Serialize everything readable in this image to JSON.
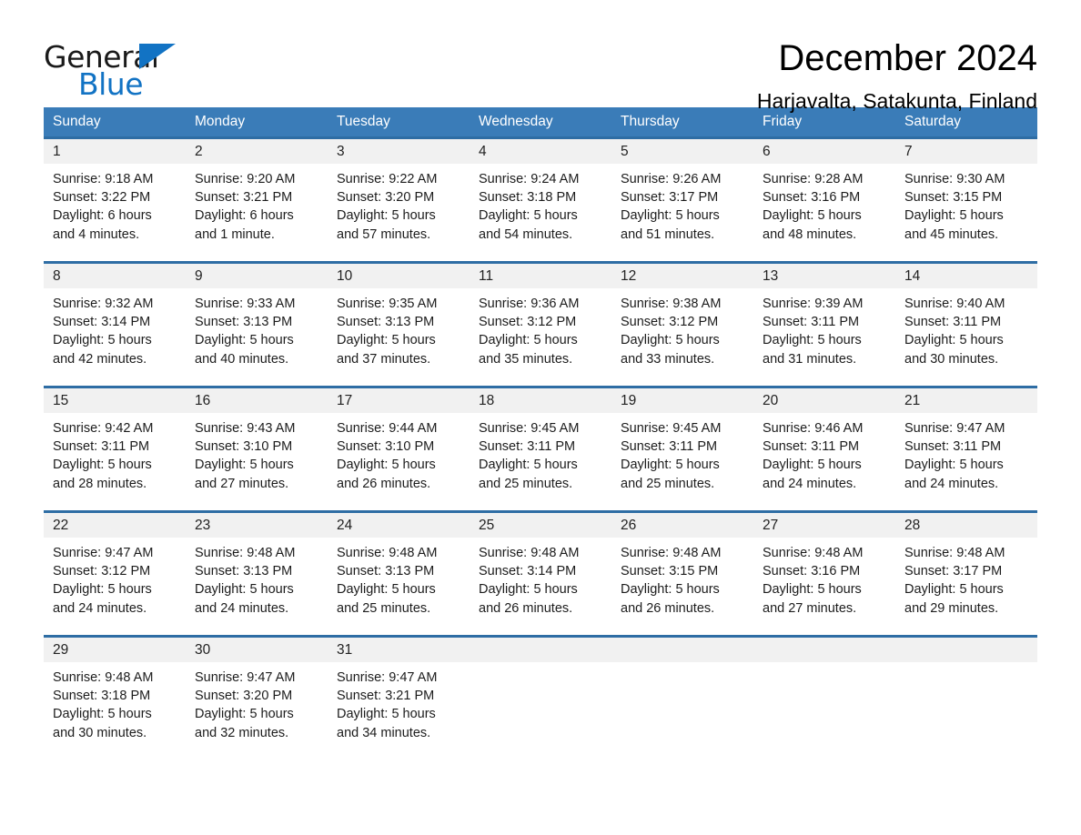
{
  "brand": {
    "name_top": "General",
    "name_bottom": "Blue",
    "accent_color": "#1273c4"
  },
  "header": {
    "title": "December 2024",
    "location": "Harjavalta, Satakunta, Finland"
  },
  "theme": {
    "header_bg": "#3a7cb8",
    "row_rule": "#2e6da4",
    "daynum_bg": "#f1f1f1"
  },
  "calendar": {
    "weekdays": [
      "Sunday",
      "Monday",
      "Tuesday",
      "Wednesday",
      "Thursday",
      "Friday",
      "Saturday"
    ],
    "weeks": [
      {
        "days": [
          {
            "date": "1",
            "sunrise": "Sunrise: 9:18 AM",
            "sunset": "Sunset: 3:22 PM",
            "daylight_line1": "Daylight: 6 hours",
            "daylight_line2": "and 4 minutes."
          },
          {
            "date": "2",
            "sunrise": "Sunrise: 9:20 AM",
            "sunset": "Sunset: 3:21 PM",
            "daylight_line1": "Daylight: 6 hours",
            "daylight_line2": "and 1 minute."
          },
          {
            "date": "3",
            "sunrise": "Sunrise: 9:22 AM",
            "sunset": "Sunset: 3:20 PM",
            "daylight_line1": "Daylight: 5 hours",
            "daylight_line2": "and 57 minutes."
          },
          {
            "date": "4",
            "sunrise": "Sunrise: 9:24 AM",
            "sunset": "Sunset: 3:18 PM",
            "daylight_line1": "Daylight: 5 hours",
            "daylight_line2": "and 54 minutes."
          },
          {
            "date": "5",
            "sunrise": "Sunrise: 9:26 AM",
            "sunset": "Sunset: 3:17 PM",
            "daylight_line1": "Daylight: 5 hours",
            "daylight_line2": "and 51 minutes."
          },
          {
            "date": "6",
            "sunrise": "Sunrise: 9:28 AM",
            "sunset": "Sunset: 3:16 PM",
            "daylight_line1": "Daylight: 5 hours",
            "daylight_line2": "and 48 minutes."
          },
          {
            "date": "7",
            "sunrise": "Sunrise: 9:30 AM",
            "sunset": "Sunset: 3:15 PM",
            "daylight_line1": "Daylight: 5 hours",
            "daylight_line2": "and 45 minutes."
          }
        ]
      },
      {
        "days": [
          {
            "date": "8",
            "sunrise": "Sunrise: 9:32 AM",
            "sunset": "Sunset: 3:14 PM",
            "daylight_line1": "Daylight: 5 hours",
            "daylight_line2": "and 42 minutes."
          },
          {
            "date": "9",
            "sunrise": "Sunrise: 9:33 AM",
            "sunset": "Sunset: 3:13 PM",
            "daylight_line1": "Daylight: 5 hours",
            "daylight_line2": "and 40 minutes."
          },
          {
            "date": "10",
            "sunrise": "Sunrise: 9:35 AM",
            "sunset": "Sunset: 3:13 PM",
            "daylight_line1": "Daylight: 5 hours",
            "daylight_line2": "and 37 minutes."
          },
          {
            "date": "11",
            "sunrise": "Sunrise: 9:36 AM",
            "sunset": "Sunset: 3:12 PM",
            "daylight_line1": "Daylight: 5 hours",
            "daylight_line2": "and 35 minutes."
          },
          {
            "date": "12",
            "sunrise": "Sunrise: 9:38 AM",
            "sunset": "Sunset: 3:12 PM",
            "daylight_line1": "Daylight: 5 hours",
            "daylight_line2": "and 33 minutes."
          },
          {
            "date": "13",
            "sunrise": "Sunrise: 9:39 AM",
            "sunset": "Sunset: 3:11 PM",
            "daylight_line1": "Daylight: 5 hours",
            "daylight_line2": "and 31 minutes."
          },
          {
            "date": "14",
            "sunrise": "Sunrise: 9:40 AM",
            "sunset": "Sunset: 3:11 PM",
            "daylight_line1": "Daylight: 5 hours",
            "daylight_line2": "and 30 minutes."
          }
        ]
      },
      {
        "days": [
          {
            "date": "15",
            "sunrise": "Sunrise: 9:42 AM",
            "sunset": "Sunset: 3:11 PM",
            "daylight_line1": "Daylight: 5 hours",
            "daylight_line2": "and 28 minutes."
          },
          {
            "date": "16",
            "sunrise": "Sunrise: 9:43 AM",
            "sunset": "Sunset: 3:10 PM",
            "daylight_line1": "Daylight: 5 hours",
            "daylight_line2": "and 27 minutes."
          },
          {
            "date": "17",
            "sunrise": "Sunrise: 9:44 AM",
            "sunset": "Sunset: 3:10 PM",
            "daylight_line1": "Daylight: 5 hours",
            "daylight_line2": "and 26 minutes."
          },
          {
            "date": "18",
            "sunrise": "Sunrise: 9:45 AM",
            "sunset": "Sunset: 3:11 PM",
            "daylight_line1": "Daylight: 5 hours",
            "daylight_line2": "and 25 minutes."
          },
          {
            "date": "19",
            "sunrise": "Sunrise: 9:45 AM",
            "sunset": "Sunset: 3:11 PM",
            "daylight_line1": "Daylight: 5 hours",
            "daylight_line2": "and 25 minutes."
          },
          {
            "date": "20",
            "sunrise": "Sunrise: 9:46 AM",
            "sunset": "Sunset: 3:11 PM",
            "daylight_line1": "Daylight: 5 hours",
            "daylight_line2": "and 24 minutes."
          },
          {
            "date": "21",
            "sunrise": "Sunrise: 9:47 AM",
            "sunset": "Sunset: 3:11 PM",
            "daylight_line1": "Daylight: 5 hours",
            "daylight_line2": "and 24 minutes."
          }
        ]
      },
      {
        "days": [
          {
            "date": "22",
            "sunrise": "Sunrise: 9:47 AM",
            "sunset": "Sunset: 3:12 PM",
            "daylight_line1": "Daylight: 5 hours",
            "daylight_line2": "and 24 minutes."
          },
          {
            "date": "23",
            "sunrise": "Sunrise: 9:48 AM",
            "sunset": "Sunset: 3:13 PM",
            "daylight_line1": "Daylight: 5 hours",
            "daylight_line2": "and 24 minutes."
          },
          {
            "date": "24",
            "sunrise": "Sunrise: 9:48 AM",
            "sunset": "Sunset: 3:13 PM",
            "daylight_line1": "Daylight: 5 hours",
            "daylight_line2": "and 25 minutes."
          },
          {
            "date": "25",
            "sunrise": "Sunrise: 9:48 AM",
            "sunset": "Sunset: 3:14 PM",
            "daylight_line1": "Daylight: 5 hours",
            "daylight_line2": "and 26 minutes."
          },
          {
            "date": "26",
            "sunrise": "Sunrise: 9:48 AM",
            "sunset": "Sunset: 3:15 PM",
            "daylight_line1": "Daylight: 5 hours",
            "daylight_line2": "and 26 minutes."
          },
          {
            "date": "27",
            "sunrise": "Sunrise: 9:48 AM",
            "sunset": "Sunset: 3:16 PM",
            "daylight_line1": "Daylight: 5 hours",
            "daylight_line2": "and 27 minutes."
          },
          {
            "date": "28",
            "sunrise": "Sunrise: 9:48 AM",
            "sunset": "Sunset: 3:17 PM",
            "daylight_line1": "Daylight: 5 hours",
            "daylight_line2": "and 29 minutes."
          }
        ]
      },
      {
        "days": [
          {
            "date": "29",
            "sunrise": "Sunrise: 9:48 AM",
            "sunset": "Sunset: 3:18 PM",
            "daylight_line1": "Daylight: 5 hours",
            "daylight_line2": "and 30 minutes."
          },
          {
            "date": "30",
            "sunrise": "Sunrise: 9:47 AM",
            "sunset": "Sunset: 3:20 PM",
            "daylight_line1": "Daylight: 5 hours",
            "daylight_line2": "and 32 minutes."
          },
          {
            "date": "31",
            "sunrise": "Sunrise: 9:47 AM",
            "sunset": "Sunset: 3:21 PM",
            "daylight_line1": "Daylight: 5 hours",
            "daylight_line2": "and 34 minutes."
          },
          {
            "date": "",
            "sunrise": "",
            "sunset": "",
            "daylight_line1": "",
            "daylight_line2": ""
          },
          {
            "date": "",
            "sunrise": "",
            "sunset": "",
            "daylight_line1": "",
            "daylight_line2": ""
          },
          {
            "date": "",
            "sunrise": "",
            "sunset": "",
            "daylight_line1": "",
            "daylight_line2": ""
          },
          {
            "date": "",
            "sunrise": "",
            "sunset": "",
            "daylight_line1": "",
            "daylight_line2": ""
          }
        ]
      }
    ]
  }
}
